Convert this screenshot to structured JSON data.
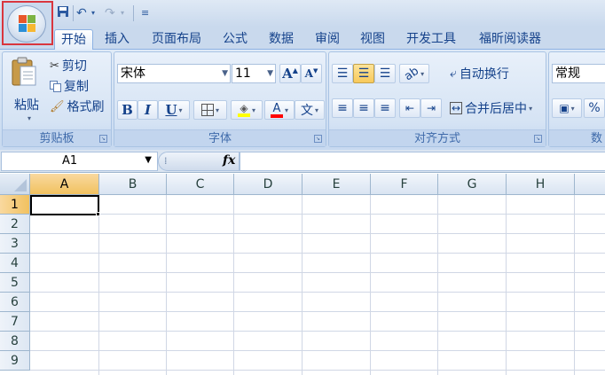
{
  "tabs": [
    "开始",
    "插入",
    "页面布局",
    "公式",
    "数据",
    "审阅",
    "视图",
    "开发工具",
    "福昕阅读器"
  ],
  "clipboard": {
    "paste_label": "粘贴",
    "cut_label": "剪切",
    "copy_label": "复制",
    "format_painter_label": "格式刷",
    "group_label": "剪贴板"
  },
  "font": {
    "font_name": "宋体",
    "font_size": "11",
    "grow_label": "A",
    "shrink_label": "A",
    "bold_label": "B",
    "italic_label": "I",
    "underline_label": "U",
    "phonetic_label": "文",
    "group_label": "字体",
    "highlight_color": "#ffff00",
    "font_color": "#ff0000"
  },
  "alignment": {
    "wrap_text_label": "自动换行",
    "merge_center_label": "合并后居中",
    "group_label": "对齐方式"
  },
  "number": {
    "format_value": "常规",
    "percent_label": "%",
    "group_label": "数"
  },
  "formula_bar": {
    "name_box": "A1",
    "fx_label": "fx",
    "formula": ""
  },
  "sheet": {
    "columns": [
      "A",
      "B",
      "C",
      "D",
      "E",
      "F",
      "G",
      "H"
    ],
    "rows": [
      "1",
      "2",
      "3",
      "4",
      "5",
      "6",
      "7",
      "8",
      "9"
    ],
    "active_cell": "A1"
  },
  "colors": {
    "accent": "#15428b",
    "highlight_box": "#d9363e"
  }
}
